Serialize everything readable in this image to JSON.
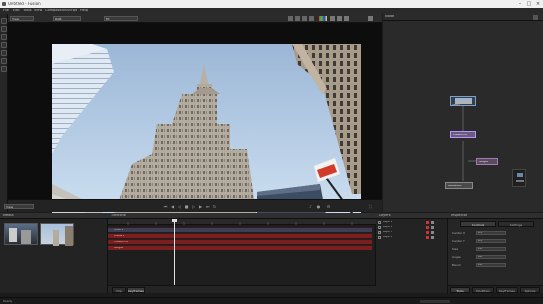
{
  "window": {
    "title": "Untitled - Fusion",
    "controls": [
      "minimize",
      "maximize",
      "close"
    ]
  },
  "menu": [
    "File",
    "Edit",
    "Tools",
    "View",
    "Composition",
    "Script",
    "Help"
  ],
  "viewer": {
    "view_combo": "View",
    "channel_combo": "RGB",
    "zoom_combo": "Fit",
    "playback_icons": [
      "jump-start-icon",
      "step-back-icon",
      "play-reverse-icon",
      "stop-icon",
      "play-icon",
      "step-forward-icon",
      "jump-end-icon",
      "loop-icon"
    ],
    "colors": {
      "sky_top": "#9fb9d8",
      "sky_bottom": "#c8dcef",
      "building": "#b8b1a6",
      "accent": "#d23a2a"
    }
  },
  "nodes": {
    "items": [
      {
        "label": "Loader1"
      },
      {
        "label": "Transform1"
      },
      {
        "label": "Merge1"
      },
      {
        "label": "MediaOut1"
      }
    ]
  },
  "media_panel": {
    "title": "Media"
  },
  "timeline": {
    "title": "Timeline",
    "tracks": [
      "Video 1",
      "Loader1",
      "Transform1",
      "Merge1"
    ],
    "tabs": [
      "Clip",
      "Keyframes"
    ],
    "colors": {
      "track": "#7a1f1f",
      "track_selected": "#3a3f55",
      "playhead": "#e0e0e0"
    }
  },
  "layers": {
    "title": "Layers",
    "items": [
      "Layer 1",
      "Layer 2",
      "Layer 3",
      "Layer 4"
    ]
  },
  "inspector": {
    "title": "Inspector",
    "tabs": [
      "Controls",
      "Settings"
    ],
    "rows": [
      {
        "label": "Center X",
        "value": "0.5"
      },
      {
        "label": "Center Y",
        "value": "0.5"
      },
      {
        "label": "Size",
        "value": "1.0"
      },
      {
        "label": "Angle",
        "value": "0.0"
      },
      {
        "label": "Blend",
        "value": "1.0"
      }
    ],
    "bottom_tabs": [
      "Tools",
      "Modifiers",
      "Keyframes",
      "Splines"
    ]
  },
  "status": {
    "left": "Ready"
  }
}
